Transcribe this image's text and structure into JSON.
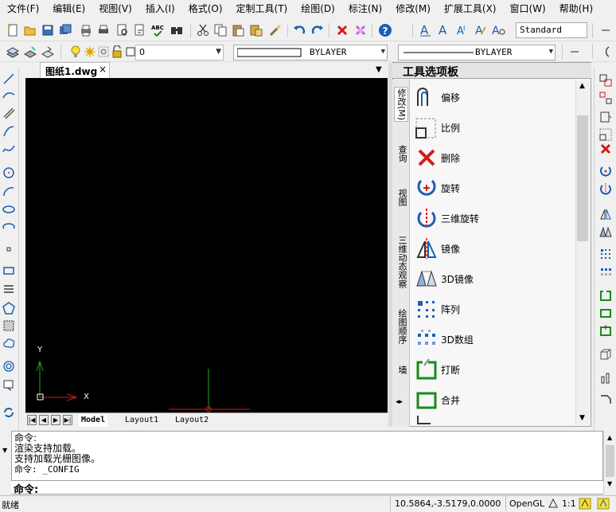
{
  "menu": [
    "文件(F)",
    "编辑(E)",
    "视图(V)",
    "插入(I)",
    "格式(O)",
    "定制工具(T)",
    "绘图(D)",
    "标注(N)",
    "修改(M)",
    "扩展工具(X)",
    "窗口(W)",
    "帮助(H)"
  ],
  "toolbar": {
    "text_style": "Standard",
    "layer_value": "0",
    "linetype_value": "BYLAYER",
    "lineweight_value": "BYLAYER"
  },
  "document": {
    "tab_title": "图纸1.dwg",
    "close_glyph": "×"
  },
  "canvas": {
    "axis_y_label": "Y",
    "axis_x_label": "X"
  },
  "layouts": [
    "Model",
    "Layout1",
    "Layout2"
  ],
  "palette": {
    "title": "工具选项板",
    "tabs": [
      "修改(M)",
      "查询",
      "视图",
      "三维动态观察",
      "绘图顺序",
      "墙"
    ],
    "tools": [
      {
        "label": "偏移",
        "icon": "offset-icon"
      },
      {
        "label": "比例",
        "icon": "scale-icon"
      },
      {
        "label": "删除",
        "icon": "delete-icon"
      },
      {
        "label": "旋转",
        "icon": "rotate-icon"
      },
      {
        "label": "三维旋转",
        "icon": "rotate-3d-icon"
      },
      {
        "label": "镜像",
        "icon": "mirror-icon"
      },
      {
        "label": "3D镜像",
        "icon": "mirror-3d-icon"
      },
      {
        "label": "阵列",
        "icon": "array-icon"
      },
      {
        "label": "3D数组",
        "icon": "array-3d-icon"
      },
      {
        "label": "打断",
        "icon": "break-icon"
      },
      {
        "label": "合并",
        "icon": "join-icon"
      }
    ]
  },
  "command": {
    "history": [
      "命令:",
      "渲染支持加载。",
      "支持加载光栅图像。",
      "命令: _CONFIG"
    ],
    "prompt": "命令:"
  },
  "status": {
    "state": "就绪",
    "coords": "10.5864,-3.5179,0.0000",
    "renderer": "OpenGL",
    "scale": "1:1"
  },
  "colors": {
    "canvas_bg": "#000000",
    "accent_blue": "#1a5fb4",
    "delete_red": "#d61a1a"
  }
}
